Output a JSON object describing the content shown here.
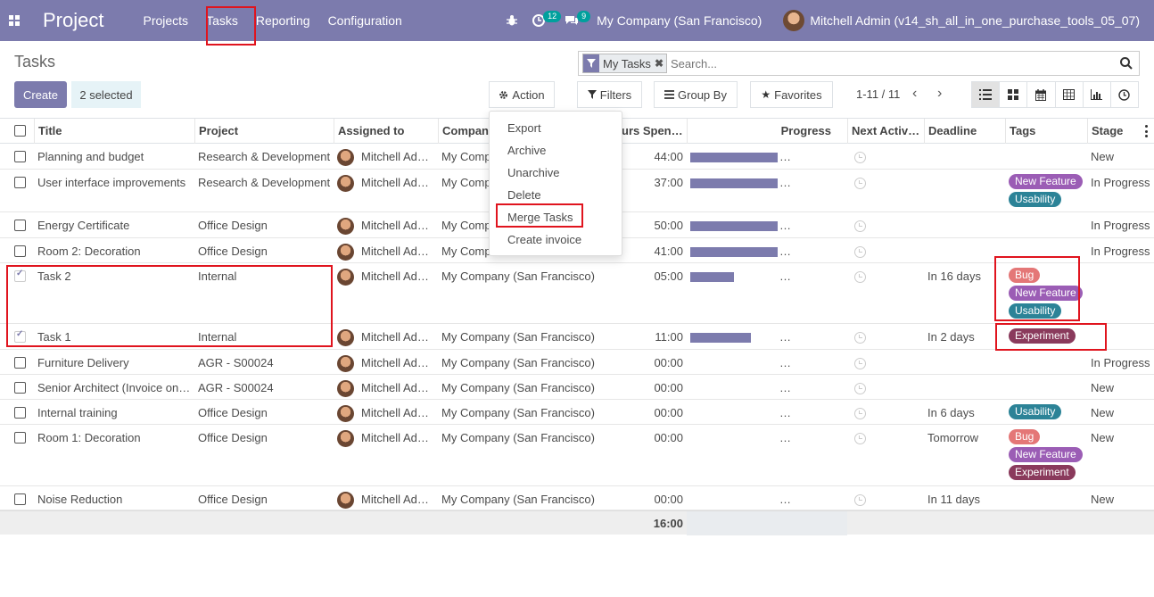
{
  "navbar": {
    "app_title": "Project",
    "menu": [
      "Projects",
      "Tasks",
      "Reporting",
      "Configuration"
    ],
    "activity_count": "12",
    "message_count": "9",
    "company": "My Company (San Francisco)",
    "user": "Mitchell Admin (v14_sh_all_in_one_purchase_tools_05_07)"
  },
  "control_panel": {
    "title": "Tasks",
    "create_label": "Create",
    "selected_label": "2 selected",
    "action_label": "Action",
    "filters_label": "Filters",
    "groupby_label": "Group By",
    "favorites_label": "Favorites",
    "pager": "1-11 / 11",
    "facet": "My Tasks",
    "search_placeholder": "Search..."
  },
  "action_menu": [
    "Export",
    "Archive",
    "Unarchive",
    "Delete",
    "Merge Tasks",
    "Create invoice"
  ],
  "table": {
    "headers": [
      "Title",
      "Project",
      "Assigned to",
      "Company",
      "Hours Spent",
      "Progress",
      "Next Activ…",
      "Deadline",
      "Tags",
      "Stage"
    ],
    "header_display": {
      "company": "Compan",
      "hours": "urs Spen…"
    },
    "rows": [
      {
        "title": "Planning and budget",
        "project": "Research & Development",
        "assigned": "Mitchell Ad…",
        "company": "My Company",
        "hours": "44:00",
        "progress": 1.0,
        "deadline": "",
        "tags": [],
        "stage": "New",
        "checked": false
      },
      {
        "title": "User interface improvements",
        "project": "Research & Development",
        "assigned": "Mitchell Ad…",
        "company": "My Comp",
        "hours": "37:00",
        "progress": 1.0,
        "deadline": "",
        "tags": [
          "New Feature",
          "Usability"
        ],
        "stage": "In Progress",
        "checked": false
      },
      {
        "title": "Energy Certificate",
        "project": "Office Design",
        "assigned": "Mitchell Ad…",
        "company": "My Comp",
        "hours": "50:00",
        "progress": 1.0,
        "deadline": "",
        "tags": [],
        "stage": "In Progress",
        "checked": false
      },
      {
        "title": "Room 2: Decoration",
        "project": "Office Design",
        "assigned": "Mitchell Ad…",
        "company": "My Comp",
        "hours": "41:00",
        "progress": 1.0,
        "deadline": "",
        "tags": [],
        "stage": "In Progress",
        "checked": false
      },
      {
        "title": "Task 2",
        "project": "Internal",
        "assigned": "Mitchell Ad…",
        "company": "My Company (San Francisco)",
        "hours": "05:00",
        "progress": 0.5,
        "deadline": "In 16 days",
        "tags": [
          "Bug",
          "New Feature",
          "Usability"
        ],
        "stage": "",
        "checked": true
      },
      {
        "title": "Task 1",
        "project": "Internal",
        "assigned": "Mitchell Ad…",
        "company": "My Company (San Francisco)",
        "hours": "11:00",
        "progress": 0.69,
        "deadline": "In 2 days",
        "tags": [
          "Experiment"
        ],
        "stage": "",
        "checked": true
      },
      {
        "title": "Furniture Delivery",
        "project": "AGR - S00024",
        "assigned": "Mitchell Ad…",
        "company": "My Company (San Francisco)",
        "hours": "00:00",
        "progress": 0,
        "deadline": "",
        "tags": [],
        "stage": "In Progress",
        "checked": false
      },
      {
        "title": "Senior Architect (Invoice on…",
        "project": "AGR - S00024",
        "assigned": "Mitchell Ad…",
        "company": "My Company (San Francisco)",
        "hours": "00:00",
        "progress": 0,
        "deadline": "",
        "tags": [],
        "stage": "New",
        "checked": false
      },
      {
        "title": "Internal training",
        "project": "Office Design",
        "assigned": "Mitchell Ad…",
        "company": "My Company (San Francisco)",
        "hours": "00:00",
        "progress": 0,
        "deadline": "In 6 days",
        "tags": [
          "Usability"
        ],
        "stage": "New",
        "checked": false
      },
      {
        "title": "Room 1: Decoration",
        "project": "Office Design",
        "assigned": "Mitchell Ad…",
        "company": "My Company (San Francisco)",
        "hours": "00:00",
        "progress": 0,
        "deadline": "Tomorrow",
        "tags": [
          "Bug",
          "New Feature",
          "Experiment"
        ],
        "stage": "New",
        "checked": false
      },
      {
        "title": "Noise Reduction",
        "project": "Office Design",
        "assigned": "Mitchell Ad…",
        "company": "My Company (San Francisco)",
        "hours": "00:00",
        "progress": 0,
        "deadline": "In 11 days",
        "tags": [],
        "stage": "New",
        "checked": false
      }
    ],
    "total_hours": "16:00",
    "ellipsis": "…"
  },
  "tag_colors": {
    "Bug": "#e47777",
    "New Feature": "#9b5db5",
    "Usability": "#2c8397",
    "Experiment": "#8a3a5c"
  },
  "colors": {
    "brand": "#7c7bad",
    "highlight": "#e0141e"
  }
}
